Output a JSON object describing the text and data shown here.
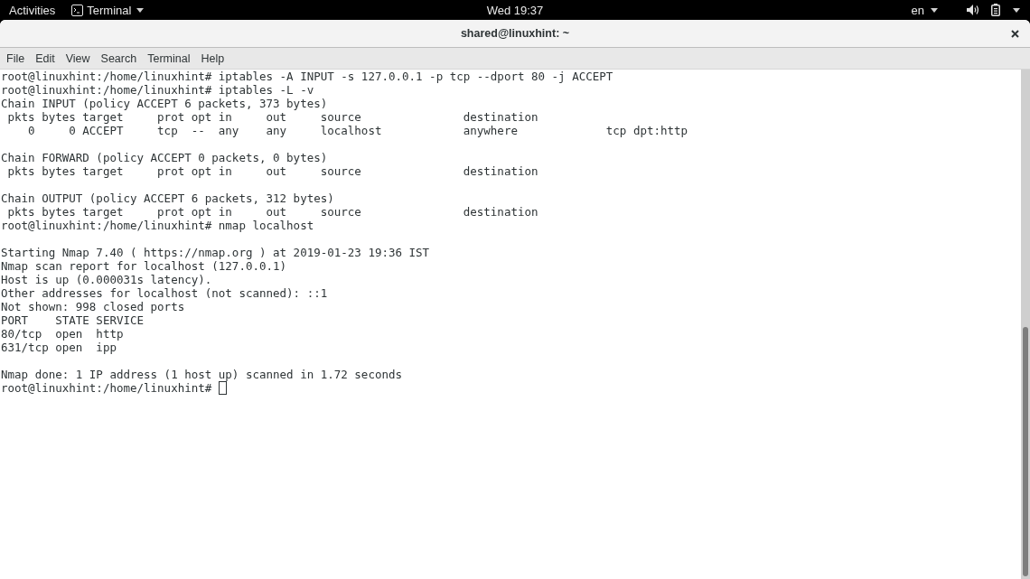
{
  "top_bar": {
    "activities": "Activities",
    "app_menu": "Terminal",
    "clock": "Wed 19:37",
    "input_source": "en"
  },
  "window": {
    "title": "shared@linuxhint: ~"
  },
  "menu_bar": {
    "items": [
      "File",
      "Edit",
      "View",
      "Search",
      "Terminal",
      "Help"
    ]
  },
  "terminal": {
    "blocks": [
      [
        "root@linuxhint:/home/linuxhint# iptables -A INPUT -s 127.0.0.1 -p tcp --dport 80 -j ACCEPT",
        "root@linuxhint:/home/linuxhint# iptables -L -v",
        "Chain INPUT (policy ACCEPT 6 packets, 373 bytes)",
        " pkts bytes target     prot opt in     out     source               destination",
        "    0     0 ACCEPT     tcp  --  any    any     localhost            anywhere             tcp dpt:http"
      ],
      [
        "Chain FORWARD (policy ACCEPT 0 packets, 0 bytes)",
        " pkts bytes target     prot opt in     out     source               destination"
      ],
      [
        "Chain OUTPUT (policy ACCEPT 6 packets, 312 bytes)",
        " pkts bytes target     prot opt in     out     source               destination",
        "root@linuxhint:/home/linuxhint# nmap localhost"
      ],
      [
        "Starting Nmap 7.40 ( https://nmap.org ) at 2019-01-23 19:36 IST",
        "Nmap scan report for localhost (127.0.0.1)",
        "Host is up (0.000031s latency).",
        "Other addresses for localhost (not scanned): ::1",
        "Not shown: 998 closed ports",
        "PORT    STATE SERVICE",
        "80/tcp  open  http",
        "631/tcp open  ipp"
      ],
      [
        "Nmap done: 1 IP address (1 host up) scanned in 1.72 seconds",
        "root@linuxhint:/home/linuxhint#"
      ]
    ],
    "cursor": true
  }
}
